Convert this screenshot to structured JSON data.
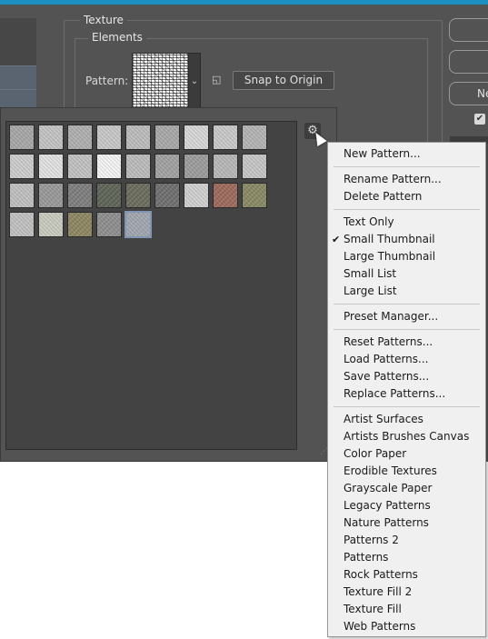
{
  "dialog": {
    "texture_legend": "Texture",
    "elements_legend": "Elements",
    "pattern_label": "Pattern:",
    "snap_button": "Snap to Origin",
    "right_buttons": [
      "",
      "",
      "Ne"
    ]
  },
  "picker": {
    "selected_index": 40,
    "swatches": [
      {
        "color": "#a8a8a8",
        "icon": "crosshatch-texture"
      },
      {
        "color": "#c4c4c4",
        "icon": "dots-texture"
      },
      {
        "color": "#b0b0b0",
        "icon": "weave-texture"
      },
      {
        "color": "#c8c8c8",
        "icon": "fine-texture"
      },
      {
        "color": "#bdbdbd",
        "icon": "grain-texture"
      },
      {
        "color": "#a9a9a9",
        "icon": "noise-texture"
      },
      {
        "color": "#d7d7d7",
        "icon": "light-texture"
      },
      {
        "color": "#c9c9c9",
        "icon": "grid-texture"
      },
      {
        "color": "#b4b4b4",
        "icon": "mesh-texture"
      },
      {
        "color": "#cdcdcd",
        "icon": "paper-texture"
      },
      {
        "color": "#e2e2e2",
        "icon": "smooth-texture"
      },
      {
        "color": "#c2c2c2",
        "icon": "stucco-texture"
      },
      {
        "color": "#f4f4f4",
        "icon": "white-texture"
      },
      {
        "color": "#bcbcbc",
        "icon": "speckle-texture"
      },
      {
        "color": "#a2a2a2",
        "icon": "gray-texture"
      },
      {
        "color": "#9d9d9d",
        "icon": "bark-texture"
      },
      {
        "color": "#b8b8b8",
        "icon": "rough-texture"
      },
      {
        "color": "#c6c6c6",
        "icon": "plaster-texture"
      },
      {
        "color": "#c0c0c0",
        "icon": "granite-texture"
      },
      {
        "color": "#9a9a9a",
        "icon": "concrete-texture"
      },
      {
        "color": "#7f7f7f",
        "icon": "stone-texture"
      },
      {
        "color": "#5f6558",
        "icon": "moss-texture"
      },
      {
        "color": "#6d6d5e",
        "icon": "pebble-texture"
      },
      {
        "color": "#707070",
        "icon": "gravel-texture"
      },
      {
        "color": "#d0d0d0",
        "icon": "sand-texture"
      },
      {
        "color": "#9e6b5d",
        "icon": "brick-texture"
      },
      {
        "color": "#8a8a66",
        "icon": "lichen-texture"
      },
      {
        "color": "#c1c1c1",
        "icon": "canvas-texture"
      },
      {
        "color": "#c9cbbf",
        "icon": "linen-texture"
      },
      {
        "color": "#8e8763",
        "icon": "burlap-texture"
      },
      {
        "color": "#8f8f8f",
        "icon": "woven-texture"
      },
      {
        "color": "#a3a7b0",
        "icon": "blue-noise-texture"
      }
    ]
  },
  "menu": {
    "sections": [
      [
        {
          "label": "New Pattern..."
        }
      ],
      [
        {
          "label": "Rename Pattern..."
        },
        {
          "label": "Delete Pattern"
        }
      ],
      [
        {
          "label": "Text Only"
        },
        {
          "label": "Small Thumbnail",
          "checked": true
        },
        {
          "label": "Large Thumbnail"
        },
        {
          "label": "Small List"
        },
        {
          "label": "Large List"
        }
      ],
      [
        {
          "label": "Preset Manager..."
        }
      ],
      [
        {
          "label": "Reset Patterns..."
        },
        {
          "label": "Load Patterns..."
        },
        {
          "label": "Save Patterns..."
        },
        {
          "label": "Replace Patterns..."
        }
      ],
      [
        {
          "label": "Artist Surfaces"
        },
        {
          "label": "Artists Brushes Canvas"
        },
        {
          "label": "Color Paper"
        },
        {
          "label": "Erodible Textures"
        },
        {
          "label": "Grayscale Paper"
        },
        {
          "label": "Legacy Patterns"
        },
        {
          "label": "Nature Patterns"
        },
        {
          "label": "Patterns 2"
        },
        {
          "label": "Patterns"
        },
        {
          "label": "Rock Patterns"
        },
        {
          "label": "Texture Fill 2"
        },
        {
          "label": "Texture Fill"
        },
        {
          "label": "Web Patterns"
        }
      ]
    ]
  },
  "icons": {
    "gear": "gear-icon",
    "cursor": "arrow-cursor-icon",
    "reset": "reset-origin-icon",
    "checkbox": "checkbox-checked-icon",
    "dropdown": "chevron-down-icon"
  }
}
